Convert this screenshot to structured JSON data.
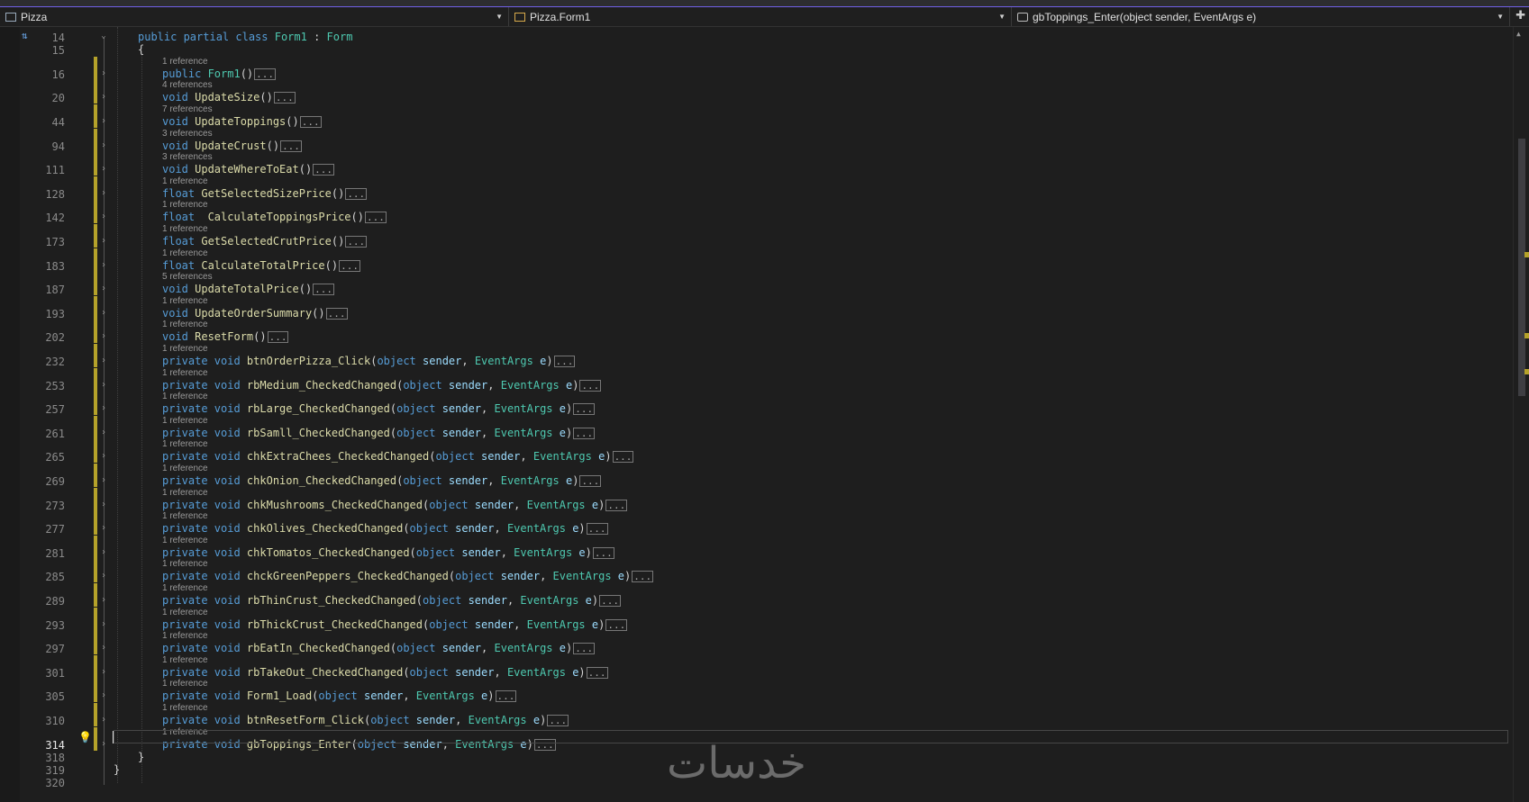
{
  "navbar": {
    "project": "Pizza",
    "type_member": "Pizza.Form1",
    "method_member": "gbToppings_Enter(object sender, EventArgs e)"
  },
  "code_lines": [
    {
      "ln": "14",
      "lens": "",
      "segs": [
        [
          "kw",
          "public partial class "
        ],
        [
          "ty",
          "Form1"
        ],
        [
          "pu",
          " : "
        ],
        [
          "ty",
          "Form"
        ]
      ]
    },
    {
      "ln": "15",
      "lens": "",
      "segs": [
        [
          "pu",
          "{"
        ]
      ]
    },
    {
      "ln": "16",
      "lens": "1 reference",
      "segs": [
        [
          "kw",
          "public "
        ],
        [
          "ty",
          "Form1"
        ],
        [
          "pu",
          "()"
        ]
      ]
    },
    {
      "ln": "20",
      "lens": "4 references",
      "segs": [
        [
          "kw",
          "void "
        ],
        [
          "fn",
          "UpdateSize"
        ],
        [
          "pu",
          "()"
        ]
      ]
    },
    {
      "ln": "44",
      "lens": "7 references",
      "segs": [
        [
          "kw",
          "void "
        ],
        [
          "fn",
          "UpdateToppings"
        ],
        [
          "pu",
          "()"
        ]
      ]
    },
    {
      "ln": "94",
      "lens": "3 references",
      "segs": [
        [
          "kw",
          "void "
        ],
        [
          "fn",
          "UpdateCrust"
        ],
        [
          "pu",
          "()"
        ]
      ]
    },
    {
      "ln": "111",
      "lens": "3 references",
      "segs": [
        [
          "kw",
          "void "
        ],
        [
          "fn",
          "UpdateWhereToEat"
        ],
        [
          "pu",
          "()"
        ]
      ]
    },
    {
      "ln": "128",
      "lens": "1 reference",
      "segs": [
        [
          "kw",
          "float "
        ],
        [
          "fn",
          "GetSelectedSizePrice"
        ],
        [
          "pu",
          "()"
        ]
      ]
    },
    {
      "ln": "142",
      "lens": "1 reference",
      "segs": [
        [
          "kw",
          "float  "
        ],
        [
          "fn",
          "CalculateToppingsPrice"
        ],
        [
          "pu",
          "()"
        ]
      ]
    },
    {
      "ln": "173",
      "lens": "1 reference",
      "segs": [
        [
          "kw",
          "float "
        ],
        [
          "fn",
          "GetSelectedCrutPrice"
        ],
        [
          "pu",
          "()"
        ]
      ]
    },
    {
      "ln": "183",
      "lens": "1 reference",
      "segs": [
        [
          "kw",
          "float "
        ],
        [
          "fn",
          "CalculateTotalPrice"
        ],
        [
          "pu",
          "()"
        ]
      ]
    },
    {
      "ln": "187",
      "lens": "5 references",
      "segs": [
        [
          "kw",
          "void "
        ],
        [
          "fn",
          "UpdateTotalPrice"
        ],
        [
          "pu",
          "()"
        ]
      ]
    },
    {
      "ln": "193",
      "lens": "1 reference",
      "segs": [
        [
          "kw",
          "void "
        ],
        [
          "fn",
          "UpdateOrderSummary"
        ],
        [
          "pu",
          "()"
        ]
      ]
    },
    {
      "ln": "202",
      "lens": "1 reference",
      "segs": [
        [
          "kw",
          "void "
        ],
        [
          "fn",
          "ResetForm"
        ],
        [
          "pu",
          "()"
        ]
      ]
    },
    {
      "ln": "232",
      "lens": "1 reference",
      "segs": [
        [
          "kw",
          "private void "
        ],
        [
          "fn",
          "btnOrderPizza_Click"
        ],
        [
          "pu",
          "("
        ],
        [
          "kw",
          "object "
        ],
        [
          "pr",
          "sender"
        ],
        [
          "pu",
          ", "
        ],
        [
          "ty",
          "EventArgs "
        ],
        [
          "pr",
          "e"
        ],
        [
          "pu",
          ")"
        ]
      ]
    },
    {
      "ln": "253",
      "lens": "1 reference",
      "segs": [
        [
          "kw",
          "private void "
        ],
        [
          "fn",
          "rbMedium_CheckedChanged"
        ],
        [
          "pu",
          "("
        ],
        [
          "kw",
          "object "
        ],
        [
          "pr",
          "sender"
        ],
        [
          "pu",
          ", "
        ],
        [
          "ty",
          "EventArgs "
        ],
        [
          "pr",
          "e"
        ],
        [
          "pu",
          ")"
        ]
      ]
    },
    {
      "ln": "257",
      "lens": "1 reference",
      "segs": [
        [
          "kw",
          "private void "
        ],
        [
          "fn",
          "rbLarge_CheckedChanged"
        ],
        [
          "pu",
          "("
        ],
        [
          "kw",
          "object "
        ],
        [
          "pr",
          "sender"
        ],
        [
          "pu",
          ", "
        ],
        [
          "ty",
          "EventArgs "
        ],
        [
          "pr",
          "e"
        ],
        [
          "pu",
          ")"
        ]
      ]
    },
    {
      "ln": "261",
      "lens": "1 reference",
      "segs": [
        [
          "kw",
          "private void "
        ],
        [
          "fn",
          "rbSamll_CheckedChanged"
        ],
        [
          "pu",
          "("
        ],
        [
          "kw",
          "object "
        ],
        [
          "pr",
          "sender"
        ],
        [
          "pu",
          ", "
        ],
        [
          "ty",
          "EventArgs "
        ],
        [
          "pr",
          "e"
        ],
        [
          "pu",
          ")"
        ]
      ]
    },
    {
      "ln": "265",
      "lens": "1 reference",
      "segs": [
        [
          "kw",
          "private void "
        ],
        [
          "fn",
          "chkExtraChees_CheckedChanged"
        ],
        [
          "pu",
          "("
        ],
        [
          "kw",
          "object "
        ],
        [
          "pr",
          "sender"
        ],
        [
          "pu",
          ", "
        ],
        [
          "ty",
          "EventArgs "
        ],
        [
          "pr",
          "e"
        ],
        [
          "pu",
          ")"
        ]
      ]
    },
    {
      "ln": "269",
      "lens": "1 reference",
      "segs": [
        [
          "kw",
          "private void "
        ],
        [
          "fn",
          "chkOnion_CheckedChanged"
        ],
        [
          "pu",
          "("
        ],
        [
          "kw",
          "object "
        ],
        [
          "pr",
          "sender"
        ],
        [
          "pu",
          ", "
        ],
        [
          "ty",
          "EventArgs "
        ],
        [
          "pr",
          "e"
        ],
        [
          "pu",
          ")"
        ]
      ]
    },
    {
      "ln": "273",
      "lens": "1 reference",
      "segs": [
        [
          "kw",
          "private void "
        ],
        [
          "fn",
          "chkMushrooms_CheckedChanged"
        ],
        [
          "pu",
          "("
        ],
        [
          "kw",
          "object "
        ],
        [
          "pr",
          "sender"
        ],
        [
          "pu",
          ", "
        ],
        [
          "ty",
          "EventArgs "
        ],
        [
          "pr",
          "e"
        ],
        [
          "pu",
          ")"
        ]
      ]
    },
    {
      "ln": "277",
      "lens": "1 reference",
      "segs": [
        [
          "kw",
          "private void "
        ],
        [
          "fn",
          "chkOlives_CheckedChanged"
        ],
        [
          "pu",
          "("
        ],
        [
          "kw",
          "object "
        ],
        [
          "pr",
          "sender"
        ],
        [
          "pu",
          ", "
        ],
        [
          "ty",
          "EventArgs "
        ],
        [
          "pr",
          "e"
        ],
        [
          "pu",
          ")"
        ]
      ]
    },
    {
      "ln": "281",
      "lens": "1 reference",
      "segs": [
        [
          "kw",
          "private void "
        ],
        [
          "fn",
          "chkTomatos_CheckedChanged"
        ],
        [
          "pu",
          "("
        ],
        [
          "kw",
          "object "
        ],
        [
          "pr",
          "sender"
        ],
        [
          "pu",
          ", "
        ],
        [
          "ty",
          "EventArgs "
        ],
        [
          "pr",
          "e"
        ],
        [
          "pu",
          ")"
        ]
      ]
    },
    {
      "ln": "285",
      "lens": "1 reference",
      "segs": [
        [
          "kw",
          "private void "
        ],
        [
          "fn",
          "chckGreenPeppers_CheckedChanged"
        ],
        [
          "pu",
          "("
        ],
        [
          "kw",
          "object "
        ],
        [
          "pr",
          "sender"
        ],
        [
          "pu",
          ", "
        ],
        [
          "ty",
          "EventArgs "
        ],
        [
          "pr",
          "e"
        ],
        [
          "pu",
          ")"
        ]
      ]
    },
    {
      "ln": "289",
      "lens": "1 reference",
      "segs": [
        [
          "kw",
          "private void "
        ],
        [
          "fn",
          "rbThinCrust_CheckedChanged"
        ],
        [
          "pu",
          "("
        ],
        [
          "kw",
          "object "
        ],
        [
          "pr",
          "sender"
        ],
        [
          "pu",
          ", "
        ],
        [
          "ty",
          "EventArgs "
        ],
        [
          "pr",
          "e"
        ],
        [
          "pu",
          ")"
        ]
      ]
    },
    {
      "ln": "293",
      "lens": "1 reference",
      "segs": [
        [
          "kw",
          "private void "
        ],
        [
          "fn",
          "rbThickCrust_CheckedChanged"
        ],
        [
          "pu",
          "("
        ],
        [
          "kw",
          "object "
        ],
        [
          "pr",
          "sender"
        ],
        [
          "pu",
          ", "
        ],
        [
          "ty",
          "EventArgs "
        ],
        [
          "pr",
          "e"
        ],
        [
          "pu",
          ")"
        ]
      ]
    },
    {
      "ln": "297",
      "lens": "1 reference",
      "segs": [
        [
          "kw",
          "private void "
        ],
        [
          "fn",
          "rbEatIn_CheckedChanged"
        ],
        [
          "pu",
          "("
        ],
        [
          "kw",
          "object "
        ],
        [
          "pr",
          "sender"
        ],
        [
          "pu",
          ", "
        ],
        [
          "ty",
          "EventArgs "
        ],
        [
          "pr",
          "e"
        ],
        [
          "pu",
          ")"
        ]
      ]
    },
    {
      "ln": "301",
      "lens": "1 reference",
      "segs": [
        [
          "kw",
          "private void "
        ],
        [
          "fn",
          "rbTakeOut_CheckedChanged"
        ],
        [
          "pu",
          "("
        ],
        [
          "kw",
          "object "
        ],
        [
          "pr",
          "sender"
        ],
        [
          "pu",
          ", "
        ],
        [
          "ty",
          "EventArgs "
        ],
        [
          "pr",
          "e"
        ],
        [
          "pu",
          ")"
        ]
      ]
    },
    {
      "ln": "305",
      "lens": "1 reference",
      "segs": [
        [
          "kw",
          "private void "
        ],
        [
          "fn",
          "Form1_Load"
        ],
        [
          "pu",
          "("
        ],
        [
          "kw",
          "object "
        ],
        [
          "pr",
          "sender"
        ],
        [
          "pu",
          ", "
        ],
        [
          "ty",
          "EventArgs "
        ],
        [
          "pr",
          "e"
        ],
        [
          "pu",
          ")"
        ]
      ]
    },
    {
      "ln": "310",
      "lens": "1 reference",
      "segs": [
        [
          "kw",
          "private void "
        ],
        [
          "fn",
          "btnResetForm_Click"
        ],
        [
          "pu",
          "("
        ],
        [
          "kw",
          "object "
        ],
        [
          "pr",
          "sender"
        ],
        [
          "pu",
          ", "
        ],
        [
          "ty",
          "EventArgs "
        ],
        [
          "pr",
          "e"
        ],
        [
          "pu",
          ")"
        ]
      ]
    },
    {
      "ln": "314",
      "lens": "1 reference",
      "segs": [
        [
          "kw",
          "private void "
        ],
        [
          "fn",
          "gbToppings_Enter"
        ],
        [
          "pu",
          "("
        ],
        [
          "kw",
          "object "
        ],
        [
          "pr",
          "sender"
        ],
        [
          "pu",
          ", "
        ],
        [
          "ty",
          "EventArgs "
        ],
        [
          "pr",
          "e"
        ],
        [
          "pu",
          ")"
        ]
      ]
    },
    {
      "ln": "318",
      "lens": "",
      "segs": [
        [
          "pu",
          "}"
        ]
      ]
    },
    {
      "ln": "319",
      "lens": "",
      "segs": [
        [
          "pu",
          "}"
        ]
      ]
    },
    {
      "ln": "320",
      "lens": "",
      "segs": []
    }
  ],
  "collapsed_marker": "...",
  "current_line": "314",
  "watermark": "خدسات",
  "colors": {
    "keyword": "#569cd6",
    "type": "#4ec9b0",
    "method": "#dcdcaa",
    "parameter": "#9cdcfe",
    "change_marker": "#b5a22a"
  }
}
